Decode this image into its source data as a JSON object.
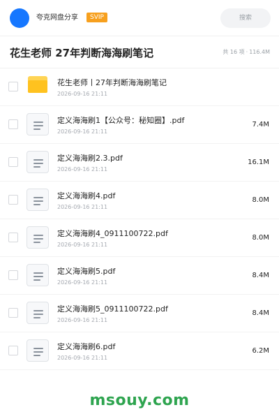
{
  "header": {
    "user_name": "夸克网盘分享",
    "badge": "SVIP",
    "search_placeholder": "搜索"
  },
  "folder": {
    "title": "花生老师 27年判断海海刷笔记",
    "item_count": "共 16 项",
    "separator": "·",
    "total_size": "116.4M"
  },
  "files": [
    {
      "type": "folder",
      "icon": "folder-icon",
      "name": "花生老师丨27年判断海海刷笔记",
      "date": "2026-09-16 21:11",
      "size": ""
    },
    {
      "type": "pdf",
      "icon": "document-icon",
      "name": "定义海海刷1【公众号：秘知圈】.pdf",
      "date": "2026-09-16 21:11",
      "size": "7.4M"
    },
    {
      "type": "pdf",
      "icon": "document-icon",
      "name": "定义海海刷2.3.pdf",
      "date": "2026-09-16 21:11",
      "size": "16.1M"
    },
    {
      "type": "pdf",
      "icon": "document-icon",
      "name": "定义海海刷4.pdf",
      "date": "2026-09-16 21:11",
      "size": "8.0M"
    },
    {
      "type": "pdf",
      "icon": "document-icon",
      "name": "定义海海刷4_0911100722.pdf",
      "date": "2026-09-16 21:11",
      "size": "8.0M"
    },
    {
      "type": "pdf",
      "icon": "document-icon",
      "name": "定义海海刷5.pdf",
      "date": "2026-09-16 21:11",
      "size": "8.4M"
    },
    {
      "type": "pdf",
      "icon": "document-icon",
      "name": "定义海海刷5_0911100722.pdf",
      "date": "2026-09-16 21:11",
      "size": "8.4M"
    },
    {
      "type": "pdf",
      "icon": "document-icon",
      "name": "定义海海刷6.pdf",
      "date": "2026-09-16 21:11",
      "size": "6.2M"
    }
  ],
  "watermark": "msouy.com",
  "colors": {
    "accent_blue": "#1677ff",
    "svip_orange": "#f7a01e",
    "folder_yellow": "#ffc21f",
    "watermark_green": "#2ea44f"
  }
}
